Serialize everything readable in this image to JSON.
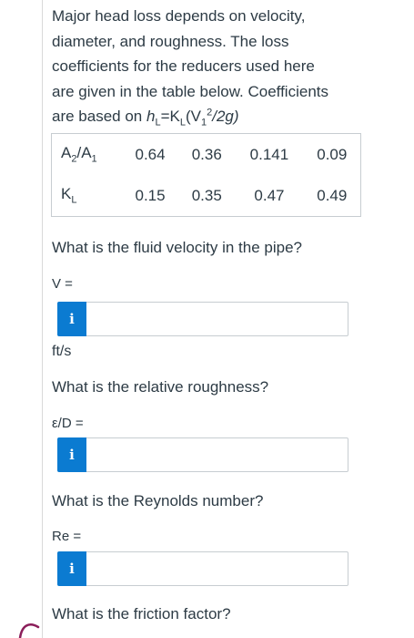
{
  "intro": {
    "line1": "Major head loss depends on velocity,",
    "line2": "diameter, and roughness. The loss",
    "line3": "coefficients for the reducers used here",
    "line4": "are given in the table below. Coefficients",
    "line5_prefix": "are based on ",
    "formula": {
      "h": "h",
      "sub_L1": "L",
      "eq": "=K",
      "sub_L2": "L",
      "open": "(V",
      "sub_1": "1",
      "sup_2": "2",
      "tail": "/2g)"
    }
  },
  "table": {
    "row1": {
      "head": {
        "a": "A",
        "a_sub": "2",
        "slash": "/A",
        "b_sub": "1"
      },
      "values": [
        "0.64",
        "0.36",
        "0.141",
        "0.09"
      ]
    },
    "row2": {
      "head": {
        "k": "K",
        "k_sub": "L"
      },
      "values": [
        "0.15",
        "0.35",
        "0.47",
        "0.49"
      ]
    }
  },
  "questions": {
    "velocity": {
      "prompt": "What is the fluid velocity in the pipe?",
      "label": "V =",
      "info_icon": "i",
      "value": "",
      "units": "ft/s"
    },
    "roughness": {
      "prompt": "What is the relative roughness?",
      "label": "ε/D =",
      "info_icon": "i",
      "value": ""
    },
    "reynolds": {
      "prompt": "What is the Reynolds number?",
      "label": "Re =",
      "info_icon": "i",
      "value": ""
    },
    "friction": {
      "prompt": "What is the friction factor?"
    }
  },
  "colors": {
    "info_button": "#0b7bd1",
    "text": "#2d3b45",
    "border": "#c7cdd1",
    "annotation_curve": "#8b1e5a"
  }
}
